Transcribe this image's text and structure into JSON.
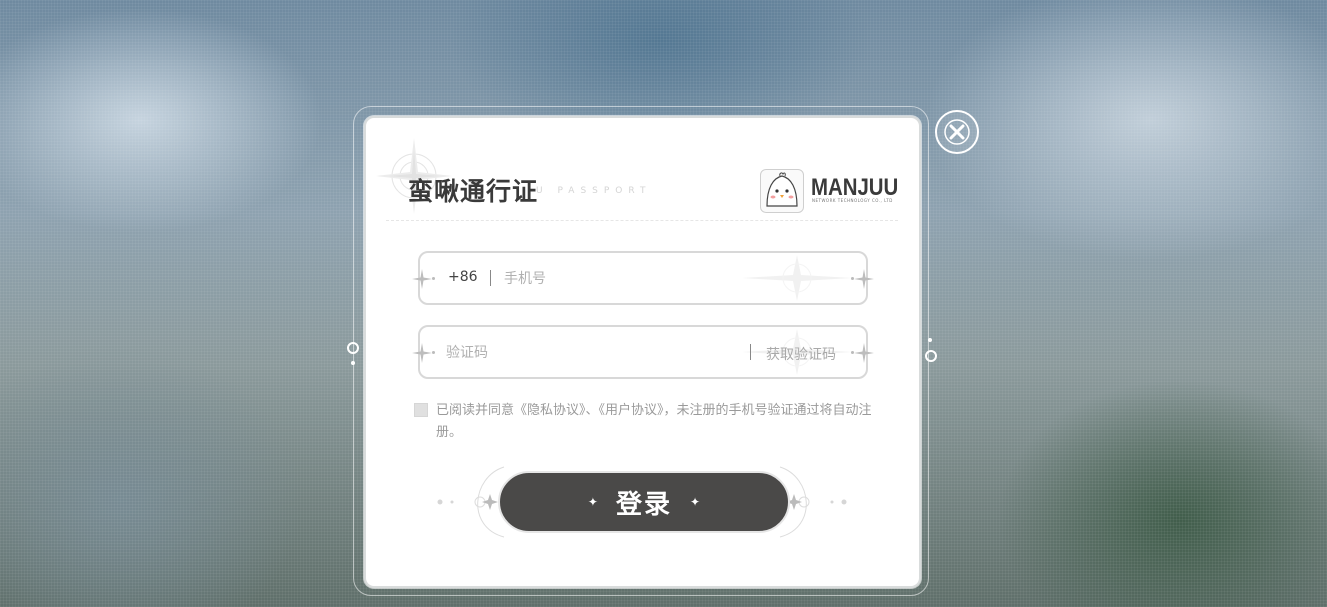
{
  "header": {
    "title": "蛮啾通行证",
    "subtitle": "U PASSPORT",
    "logo_text": "MANJUU",
    "logo_sub": "NETWORK TECHNOLOGY CO., LTD"
  },
  "phone": {
    "prefix": "+86",
    "placeholder": "手机号",
    "value": ""
  },
  "code": {
    "placeholder": "验证码",
    "value": "",
    "get_code_label": "获取验证码"
  },
  "agreement": {
    "text": "已阅读并同意《隐私协议》、《用户协议》，未注册的手机号验证通过将自动注册。",
    "checked": false
  },
  "login": {
    "label": "登录"
  },
  "icons": {
    "close": "close-icon",
    "logo": "manjuu-chick-icon"
  }
}
